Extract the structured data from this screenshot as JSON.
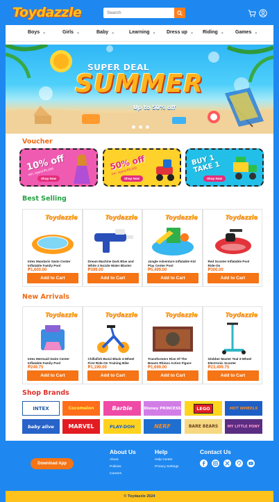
{
  "header": {
    "logo": "Toydazzle",
    "search_placeholder": "Search"
  },
  "nav": [
    {
      "label": "Boys"
    },
    {
      "label": "Girls"
    },
    {
      "label": "Baby"
    },
    {
      "label": "Learning"
    },
    {
      "label": "Dress up"
    },
    {
      "label": "Riding"
    },
    {
      "label": "Games"
    }
  ],
  "banner": {
    "line1": "SUPER DEAL",
    "line2": "SUMMER",
    "line3": "Up to 50% off"
  },
  "voucher": {
    "title": "Voucher",
    "items": [
      {
        "big": "10% off",
        "small": "min. spend ₱1,000",
        "button": "Shop Now",
        "color": "#f05bb2"
      },
      {
        "big": "50% off",
        "small": "min. spend ₱2,000",
        "button": "Shop Now",
        "color": "#ffd12b"
      },
      {
        "big": "BUY 1 TAKE 1",
        "button": "Shop Now",
        "color": "#22c0e8"
      }
    ]
  },
  "best_selling": {
    "title": "Best Selling",
    "items": [
      {
        "brand": "Toydazzle",
        "name": "Intex Mandarin Swim Center Inflatable Family Pool",
        "price": "₱1,600.00",
        "button": "Add to Cart"
      },
      {
        "brand": "Toydazzle",
        "name": "Dream Machine Dark Blue and White 2 Nozzle Water Blaster",
        "price": "₱399.00",
        "button": "Add to Cart"
      },
      {
        "brand": "Toydazzle",
        "name": "Jungle Adventure Inflatable Kid Play Center Pool",
        "price": "₱5,499.00",
        "button": "Add to Cart"
      },
      {
        "brand": "Toydazzle",
        "name": "Red Scooter Inflatable Pool Ride-On",
        "price": "₱300.00",
        "button": "Add to Cart"
      }
    ]
  },
  "new_arrivals": {
    "title": "New Arrivals",
    "items": [
      {
        "brand": "Toydazzle",
        "name": "Intex Mermaid Swim Center Inflatable Family Pool",
        "price": "₱249.75",
        "button": "Add to Cart"
      },
      {
        "brand": "Toydazzle",
        "name": "Chillafish Bunzi Black 4-Wheel First Ride-On Training Bike",
        "price": "₱1,199.00",
        "button": "Add to Cart"
      },
      {
        "brand": "Toydazzle",
        "name": "Transformers Rise Of The Beasts Rhinox Action Figure",
        "price": "₱1,699.00",
        "button": "Add to Cart"
      },
      {
        "brand": "Toydazzle",
        "name": "Globber Master Teal 3-Wheel Electronic Scooter",
        "price": "₱23,499.75",
        "button": "Add to Cart"
      }
    ]
  },
  "shop_brands": {
    "title": "Shop Brands",
    "items": [
      {
        "label": "INTEX",
        "color": "#1f5aa8"
      },
      {
        "label": "Cocomelon",
        "color": "#ff6e1a"
      },
      {
        "label": "Barbie",
        "color": "#ef4aa6"
      },
      {
        "label": "Disney PRINCESS",
        "color": "#d27de6"
      },
      {
        "label": "LEGO",
        "color": "#e31c23"
      },
      {
        "label": "HOT WHEELS",
        "color": "#1e5fc7"
      },
      {
        "label": "baby alive",
        "color": "#2763c9"
      },
      {
        "label": "MARVEL",
        "color": "#e31c23"
      },
      {
        "label": "PLAY-DOH",
        "color": "#ffd21e"
      },
      {
        "label": "NERF",
        "color": "#1e6fd0"
      },
      {
        "label": "BARE BEARS",
        "color": "#f5d880"
      },
      {
        "label": "MY LITTLE PONY",
        "color": "#5a2d82"
      }
    ]
  },
  "footer": {
    "download_button": "Download App",
    "about": {
      "title": "About Us",
      "links": [
        "About",
        "Policies",
        "Careers"
      ]
    },
    "help": {
      "title": "Help",
      "links": [
        "Help Center",
        "Privacy Settings"
      ]
    },
    "contact": {
      "title": "Contact Us",
      "icons": [
        "facebook-icon",
        "instagram-icon",
        "x-icon",
        "pinterest-icon",
        "youtube-icon"
      ]
    },
    "copyright": "© Toydazzle 2024"
  },
  "colors": {
    "primary": "#1e88f0",
    "accent": "#f57415",
    "yellow": "#ffc21c"
  }
}
